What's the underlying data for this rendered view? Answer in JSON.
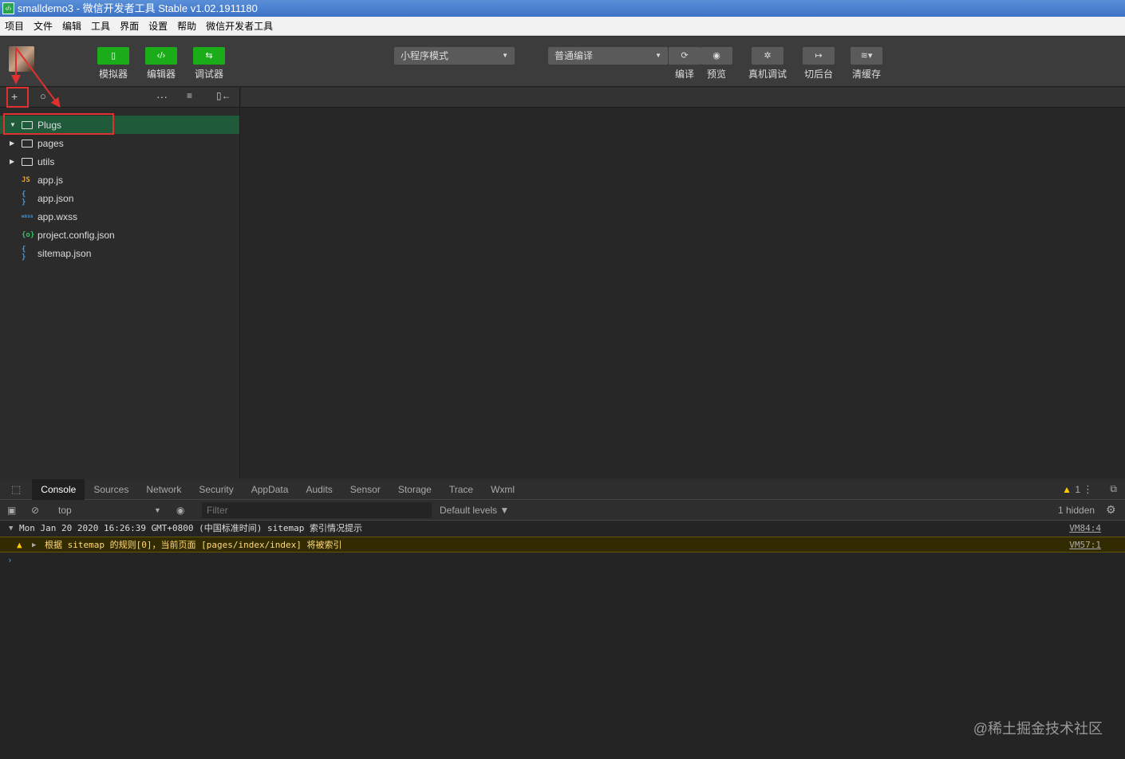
{
  "window": {
    "title": "smalldemo3 - 微信开发者工具 Stable v1.02.1911180"
  },
  "menu": [
    "项目",
    "文件",
    "编辑",
    "工具",
    "界面",
    "设置",
    "帮助",
    "微信开发者工具"
  ],
  "toolbar": {
    "left_buttons": [
      {
        "icon": "phone-icon",
        "label": "模拟器"
      },
      {
        "icon": "code-icon",
        "label": "编辑器"
      },
      {
        "icon": "debug-icon",
        "label": "调试器"
      }
    ],
    "mode_select": "小程序模式",
    "compile_select": "普通编译",
    "right_buttons": [
      {
        "icon": "refresh-icon",
        "label": "编译"
      },
      {
        "icon": "eye-icon",
        "label": "预览"
      },
      {
        "icon": "bug-icon",
        "label": "真机调试"
      },
      {
        "icon": "switch-icon",
        "label": "切后台"
      },
      {
        "icon": "layers-icon",
        "label": "清缓存"
      }
    ]
  },
  "files": [
    {
      "type": "folder",
      "name": "Plugs",
      "expanded": true,
      "selected": true
    },
    {
      "type": "folder",
      "name": "pages",
      "expanded": false
    },
    {
      "type": "folder",
      "name": "utils",
      "expanded": false
    },
    {
      "type": "js",
      "badge": "JS",
      "name": "app.js",
      "color": "#e8a33d"
    },
    {
      "type": "json",
      "badge": "{ }",
      "name": "app.json",
      "color": "#3d9be8"
    },
    {
      "type": "wxss",
      "badge": "wxss",
      "name": "app.wxss",
      "color": "#3d9be8"
    },
    {
      "type": "config",
      "badge": "{o}",
      "name": "project.config.json",
      "color": "#3dbf6a"
    },
    {
      "type": "json",
      "badge": "{ }",
      "name": "sitemap.json",
      "color": "#3d9be8"
    }
  ],
  "devtools": {
    "tabs": [
      "Console",
      "Sources",
      "Network",
      "Security",
      "AppData",
      "Audits",
      "Sensor",
      "Storage",
      "Trace",
      "Wxml"
    ],
    "active_tab": "Console",
    "warning_count": "1",
    "context": "top",
    "filter_placeholder": "Filter",
    "levels": "Default levels ▼",
    "hidden": "1 hidden",
    "logs": [
      {
        "text": "Mon Jan 20 2020 16:26:39 GMT+0800 (中国标准时间) sitemap 索引情况提示",
        "source": "VM84:4",
        "level": "info"
      },
      {
        "text": "根据 sitemap 的规则[0]，当前页面 [pages/index/index] 将被索引",
        "source": "VM57:1",
        "level": "warn"
      }
    ]
  },
  "watermark": "@稀土掘金技术社区"
}
